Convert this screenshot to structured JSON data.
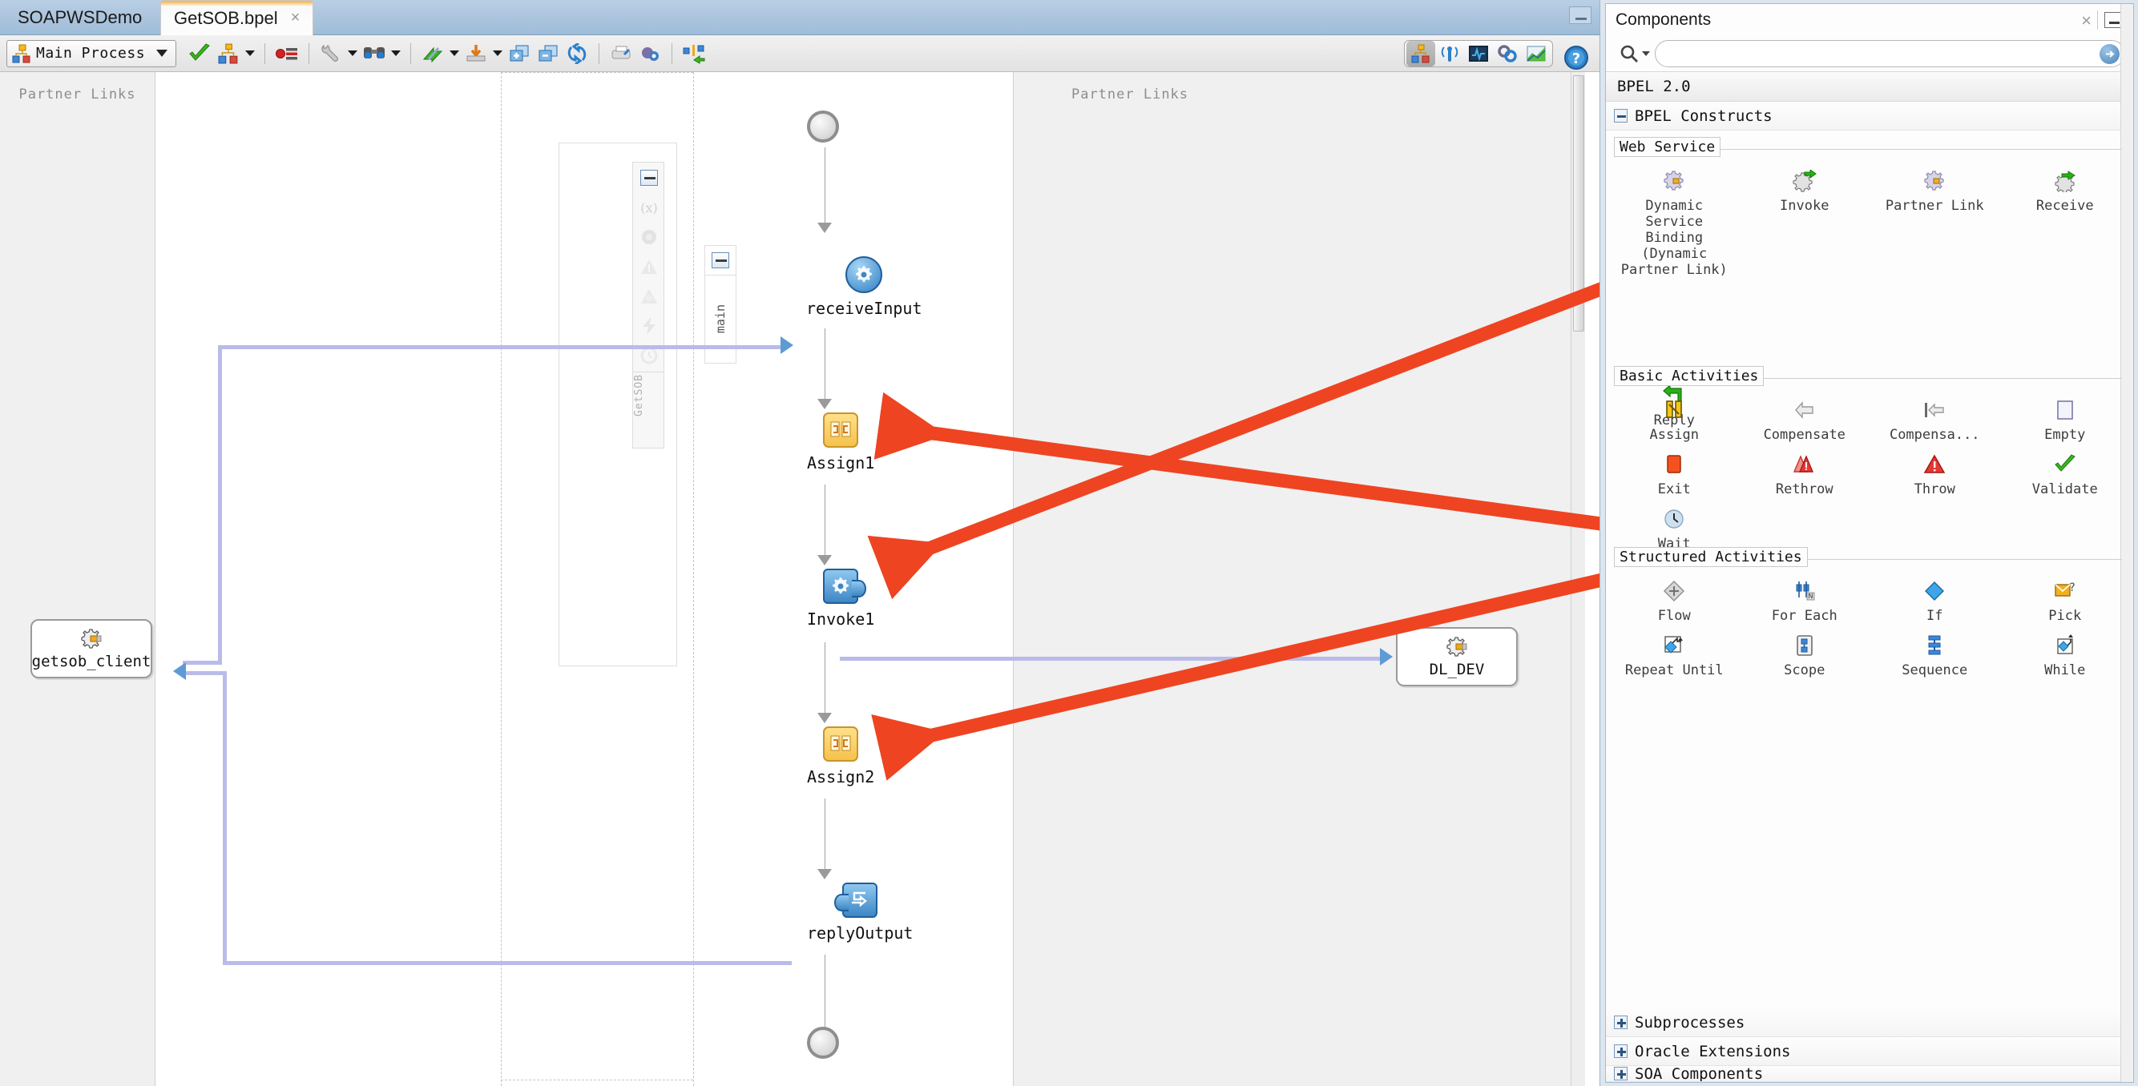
{
  "tabs": [
    {
      "label": "SOAPWSDemo",
      "active": false,
      "closable": false
    },
    {
      "label": "GetSOB.bpel",
      "active": true,
      "closable": true,
      "close": "×"
    }
  ],
  "toolbar": {
    "process_selector": "Main Process",
    "buttons": [
      {
        "name": "validate-button",
        "icon": "green-check-icon"
      },
      {
        "name": "partner-link-button",
        "icon": "partner-link-icon",
        "dropdown": true
      },
      {
        "name": "breakpoint-button",
        "icon": "breakpoint-list-icon"
      },
      {
        "name": "tools-button",
        "icon": "wrench-icon",
        "dropdown": true
      },
      {
        "name": "find-button",
        "icon": "binoculars-icon",
        "dropdown": true
      },
      {
        "name": "import-button",
        "icon": "green-arrows-icon",
        "dropdown": true
      },
      {
        "name": "deploy-button",
        "icon": "deploy-icon",
        "dropdown": true
      },
      {
        "name": "zoom-in-button",
        "icon": "zoom-in-icon"
      },
      {
        "name": "zoom-out-button",
        "icon": "zoom-out-icon"
      },
      {
        "name": "refresh-button",
        "icon": "refresh-icon"
      },
      {
        "name": "print-button",
        "icon": "printer-icon"
      },
      {
        "name": "settings-button",
        "icon": "settings-icon"
      },
      {
        "name": "swap-button",
        "icon": "swap-icon"
      }
    ],
    "view_group": [
      {
        "name": "view-design-button",
        "icon": "process-tree-icon",
        "selected": true
      },
      {
        "name": "view-monitor-button",
        "icon": "antenna-icon",
        "selected": false
      },
      {
        "name": "view-sensors-button",
        "icon": "waveform-icon",
        "selected": false
      },
      {
        "name": "view-policies-button",
        "icon": "chain-icon",
        "selected": false
      },
      {
        "name": "view-analytics-button",
        "icon": "chart-icon",
        "selected": false
      }
    ],
    "help_label": "?"
  },
  "canvas": {
    "partner_links_left_header": "Partner Links",
    "partner_links_right_header": "Partner Links",
    "scope_label": "main",
    "process_tab_label": "GetSOB",
    "partner_link_left": {
      "label": "getsob_client",
      "icon": "gear-service-icon"
    },
    "partner_link_right": {
      "label": "DL_DEV",
      "icon": "gear-service-icon"
    },
    "nodes": [
      {
        "id": "start",
        "label": "",
        "type": "start-circle"
      },
      {
        "id": "receiveInput",
        "label": "receiveInput",
        "type": "receive"
      },
      {
        "id": "Assign1",
        "label": "Assign1",
        "type": "assign"
      },
      {
        "id": "Invoke1",
        "label": "Invoke1",
        "type": "invoke"
      },
      {
        "id": "Assign2",
        "label": "Assign2",
        "type": "assign"
      },
      {
        "id": "replyOutput",
        "label": "replyOutput",
        "type": "reply"
      },
      {
        "id": "end",
        "label": "",
        "type": "end-circle"
      }
    ],
    "vertical_palette_icons": [
      "collapse-icon",
      "variable-icon",
      "correlation-icon",
      "fault-handler-icon",
      "compensation-handler-icon",
      "event-handler-icon",
      "termination-handler-icon"
    ],
    "annotation_arrow_color": "#ee4422",
    "link_color": "#b9bbe8"
  },
  "panel": {
    "title": "Components",
    "close_label": "×",
    "search_placeholder": "",
    "search_value": "",
    "search_icon": "magnifier-icon",
    "go_icon": "arrow-right-circle-icon",
    "version_bar": "BPEL 2.0",
    "tree": [
      {
        "label": "BPEL Constructs",
        "expanded": true
      },
      {
        "label": "Subprocesses",
        "expanded": false
      },
      {
        "label": "Oracle Extensions",
        "expanded": false
      },
      {
        "label": "SOA Components",
        "expanded": false
      }
    ],
    "groups": [
      {
        "title": "Web Service",
        "items": [
          {
            "label": "Dynamic Service Binding (Dynamic Partner Link)",
            "icon": "dynamic-service-icon"
          },
          {
            "label": "Invoke",
            "icon": "invoke-icon"
          },
          {
            "label": "Partner Link",
            "icon": "partner-link-icon"
          },
          {
            "label": "Receive",
            "icon": "receive-icon"
          },
          {
            "label": "Reply",
            "icon": "reply-icon"
          }
        ]
      },
      {
        "title": "Basic Activities",
        "items": [
          {
            "label": "Assign",
            "icon": "assign-icon"
          },
          {
            "label": "Compensate",
            "icon": "compensate-icon"
          },
          {
            "label": "Compensa...",
            "icon": "compensate-scope-icon"
          },
          {
            "label": "Empty",
            "icon": "empty-icon"
          },
          {
            "label": "Exit",
            "icon": "exit-icon"
          },
          {
            "label": "Rethrow",
            "icon": "rethrow-icon"
          },
          {
            "label": "Throw",
            "icon": "throw-icon"
          },
          {
            "label": "Validate",
            "icon": "validate-icon"
          },
          {
            "label": "Wait",
            "icon": "wait-icon"
          }
        ]
      },
      {
        "title": "Structured Activities",
        "items": [
          {
            "label": "Flow",
            "icon": "flow-icon"
          },
          {
            "label": "For Each",
            "icon": "for-each-icon"
          },
          {
            "label": "If",
            "icon": "if-icon"
          },
          {
            "label": "Pick",
            "icon": "pick-icon"
          },
          {
            "label": "Repeat Until",
            "icon": "repeat-until-icon"
          },
          {
            "label": "Scope",
            "icon": "scope-icon"
          },
          {
            "label": "Sequence",
            "icon": "sequence-icon"
          },
          {
            "label": "While",
            "icon": "while-icon"
          }
        ]
      }
    ]
  }
}
